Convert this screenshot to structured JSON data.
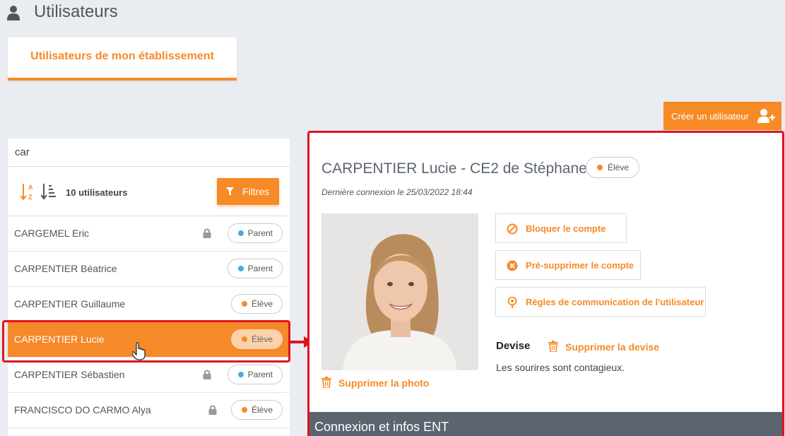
{
  "header": {
    "title": "Utilisateurs",
    "icon": "user-icon"
  },
  "tabs": [
    {
      "label": "Utilisateurs de mon établissement",
      "active": true
    }
  ],
  "create_button": {
    "label": "Créer un utilisateur",
    "icon": "user-plus-icon"
  },
  "search": {
    "value": "car"
  },
  "toolbar": {
    "count_label": "10 utilisateurs",
    "filter_label": "Filtres"
  },
  "users": [
    {
      "name": "CARGEMEL Eric",
      "locked": true,
      "role": "Parent",
      "role_color": "#4aa8e0",
      "selected": false
    },
    {
      "name": "CARPENTIER Béatrice",
      "locked": false,
      "role": "Parent",
      "role_color": "#4aa8e0",
      "selected": false
    },
    {
      "name": "CARPENTIER Guillaume",
      "locked": false,
      "role": "Élève",
      "role_color": "#f68a26",
      "selected": false
    },
    {
      "name": "CARPENTIER Lucie",
      "locked": false,
      "role": "Élève",
      "role_color": "#f68a26",
      "selected": true
    },
    {
      "name": "CARPENTIER Sébastien",
      "locked": true,
      "role": "Parent",
      "role_color": "#4aa8e0",
      "selected": false
    },
    {
      "name": "FRANCISCO DO CARMO Alya",
      "locked": true,
      "role": "Élève",
      "role_color": "#f68a26",
      "selected": false
    }
  ],
  "detail": {
    "name": "CARPENTIER Lucie - CE2 de Stéphane",
    "role": "Élève",
    "role_color": "#f68a26",
    "last_login": "Dernière connexion le 25/03/2022 18:44",
    "delete_photo_label": "Supprimer la photo",
    "actions": [
      {
        "label": "Bloquer le compte",
        "icon": "block-icon"
      },
      {
        "label": "Pré-supprimer le compte",
        "icon": "x-circle-icon"
      },
      {
        "label": "Règles de communication de l'utilisateur",
        "icon": "communication-icon"
      }
    ],
    "devise_label": "Devise",
    "delete_devise_label": "Supprimer la devise",
    "devise_text": "Les sourires sont contagieux.",
    "section_title": "Connexion et infos ENT"
  },
  "colors": {
    "accent": "#f68a26",
    "highlight": "#e0141e",
    "section_bar": "#5c6470"
  }
}
